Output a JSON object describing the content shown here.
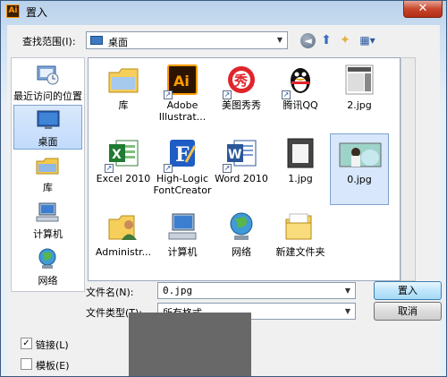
{
  "window": {
    "title": "置入",
    "app_icon": "Ai",
    "close_glyph": "✕"
  },
  "toolbar": {
    "look_in_label": "查找范围(I):",
    "look_in_value": "桌面",
    "back_glyph": "◄",
    "up_glyph": "⬆",
    "new_folder_glyph": "✦",
    "view_glyph": "▦▾"
  },
  "places": [
    {
      "label": "最近访问的位置",
      "icon": "recent-places-icon"
    },
    {
      "label": "桌面",
      "icon": "desktop-icon",
      "selected": true
    },
    {
      "label": "库",
      "icon": "libraries-icon"
    },
    {
      "label": "计算机",
      "icon": "computer-icon"
    },
    {
      "label": "网络",
      "icon": "network-icon"
    }
  ],
  "files": [
    {
      "label": "库",
      "icon": "libraries-folder-icon"
    },
    {
      "label": "Adobe Illustrat...",
      "icon": "adobe-illustrator-icon",
      "shortcut": true
    },
    {
      "label": "美图秀秀",
      "icon": "meitu-icon",
      "shortcut": true
    },
    {
      "label": "腾讯QQ",
      "icon": "qq-penguin-icon",
      "shortcut": true
    },
    {
      "label": "2.jpg",
      "icon": "image-thumbnail-icon"
    },
    {
      "label": "Excel 2010",
      "icon": "excel-icon",
      "shortcut": true
    },
    {
      "label": "High-Logic FontCreator",
      "icon": "fontcreator-icon",
      "shortcut": true
    },
    {
      "label": "Word 2010",
      "icon": "word-icon",
      "shortcut": true
    },
    {
      "label": "1.jpg",
      "icon": "image-thumbnail-icon"
    },
    {
      "label": "0.jpg",
      "icon": "image-thumbnail-icon",
      "selected": true
    },
    {
      "label": "Administr...",
      "icon": "user-folder-icon"
    },
    {
      "label": "计算机",
      "icon": "computer-icon"
    },
    {
      "label": "网络",
      "icon": "network-globe-icon"
    },
    {
      "label": "新建文件夹",
      "icon": "folder-icon"
    }
  ],
  "filename": {
    "label": "文件名(N):",
    "value": "0.jpg"
  },
  "filetype": {
    "label": "文件类型(T):",
    "value": "所有格式"
  },
  "buttons": {
    "place": "置入",
    "cancel": "取消"
  },
  "options": {
    "link": {
      "label": "链接(L)",
      "checked": true
    },
    "template": {
      "label": "模板(E)",
      "checked": false
    }
  },
  "colors": {
    "accent": "#3c7fb1",
    "selection": "#d8e7fb",
    "preview_bg": "#686868"
  }
}
